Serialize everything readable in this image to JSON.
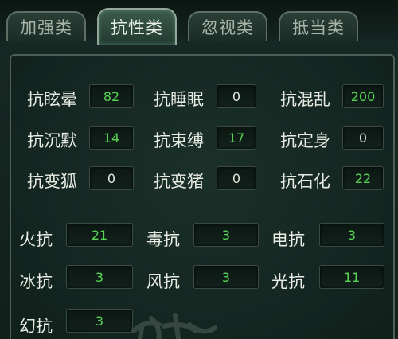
{
  "tabs": [
    {
      "label": "加强类",
      "active": false
    },
    {
      "label": "抗性类",
      "active": true
    },
    {
      "label": "忽视类",
      "active": false
    },
    {
      "label": "抵当类",
      "active": false
    }
  ],
  "control_resist": [
    {
      "label": "抗眩晕",
      "value": "82"
    },
    {
      "label": "抗睡眠",
      "value": "0"
    },
    {
      "label": "抗混乱",
      "value": "200"
    },
    {
      "label": "抗沉默",
      "value": "14"
    },
    {
      "label": "抗束缚",
      "value": "17"
    },
    {
      "label": "抗定身",
      "value": "0"
    },
    {
      "label": "抗变狐",
      "value": "0"
    },
    {
      "label": "抗变猪",
      "value": "0"
    },
    {
      "label": "抗石化",
      "value": "22"
    }
  ],
  "element_resist": [
    {
      "label": "火抗",
      "value": "21"
    },
    {
      "label": "毒抗",
      "value": "3"
    },
    {
      "label": "电抗",
      "value": "3"
    },
    {
      "label": "冰抗",
      "value": "3"
    },
    {
      "label": "风抗",
      "value": "3"
    },
    {
      "label": "光抗",
      "value": "11"
    },
    {
      "label": "幻抗",
      "value": "3"
    }
  ],
  "colors": {
    "positive_value": "#57d454",
    "zero_value": "#e2e6de",
    "label": "#e8ece4"
  }
}
